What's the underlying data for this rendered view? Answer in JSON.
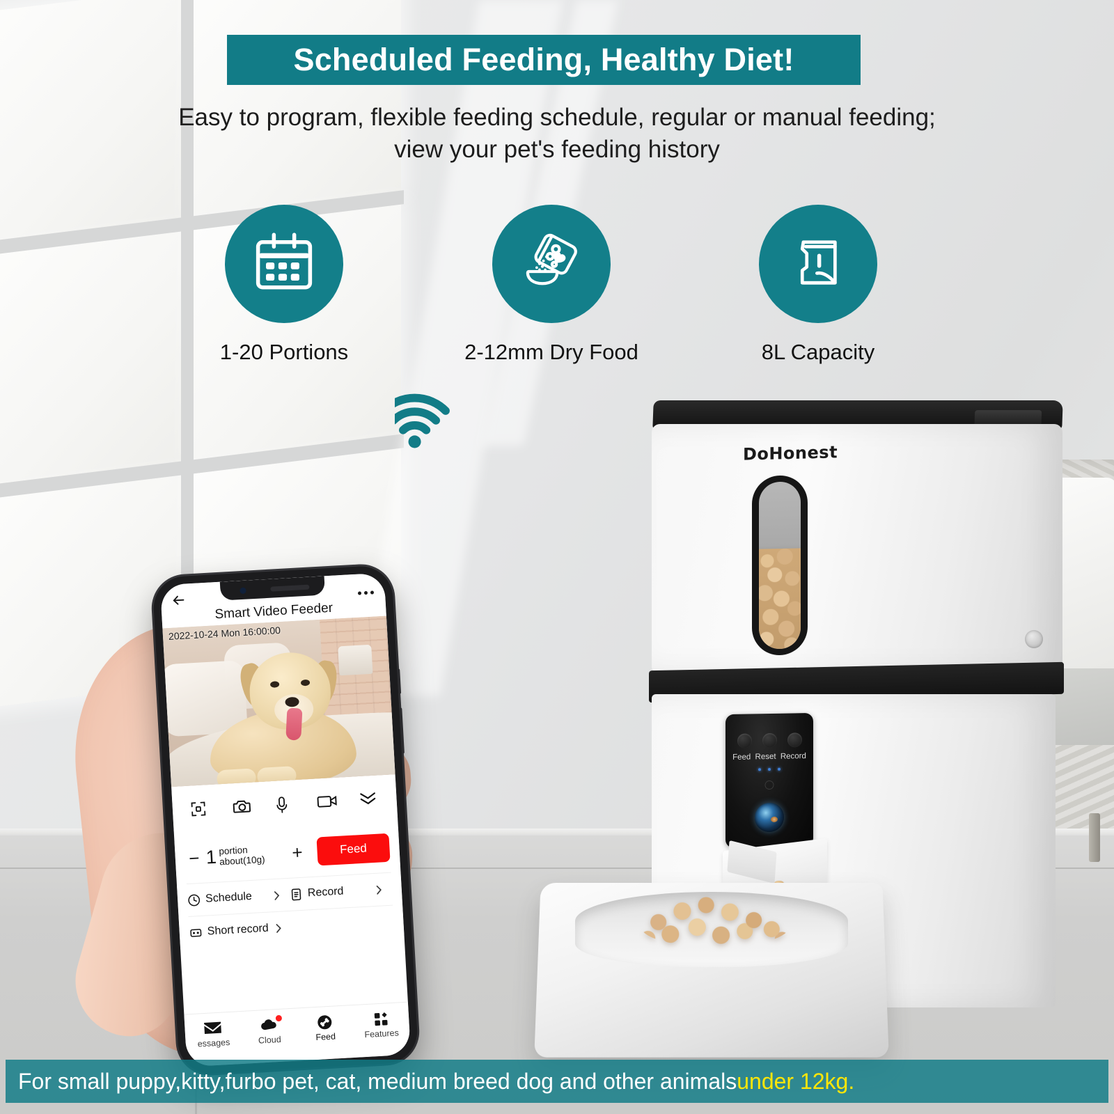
{
  "headline": "Scheduled Feeding, Healthy Diet!",
  "subheadline_line1": "Easy to program, flexible feeding schedule, regular or manual feeding;",
  "subheadline_line2": "view your pet's feeding history",
  "colors": {
    "accent_teal": "#127C87",
    "icon_bubble_teal": "#137F8A",
    "feed_button_red": "#FB0D0D",
    "highlight_yellow": "#FFE607",
    "badge_red": "#FF1F1F"
  },
  "features": [
    {
      "icon": "calendar-icon",
      "label": "1-20 Portions"
    },
    {
      "icon": "food-bag-pouring-into-bowl-icon",
      "label": "2-12mm Dry Food"
    },
    {
      "icon": "open-food-container-icon",
      "label": "8L Capacity"
    }
  ],
  "wifi": {
    "icon": "wifi-signal-icon"
  },
  "phone_app": {
    "header": {
      "back_icon": "back-arrow-icon",
      "title": "Smart Video Feeder",
      "more_icon": "more-options-icon"
    },
    "video": {
      "timestamp": "2022-10-24 Mon 16:00:00",
      "subject": "dog-live-view"
    },
    "control_icons": [
      {
        "icon": "fullscreen-icon",
        "label": "Fullscreen"
      },
      {
        "icon": "camera-icon",
        "label": "Snapshot"
      },
      {
        "icon": "microphone-icon",
        "label": "Talk"
      },
      {
        "icon": "video-camera-icon",
        "label": "Record video"
      },
      {
        "icon": "chevron-double-down-icon",
        "label": "More"
      }
    ],
    "portion": {
      "minus_label": "−",
      "count": "1",
      "unit_line1": "portion",
      "unit_line2": "about(10g)",
      "plus_label": "+",
      "feed_button_label": "Feed"
    },
    "links": [
      {
        "icon": "clock-icon",
        "label": "Schedule",
        "chevron": "chevron-right-icon"
      },
      {
        "icon": "document-icon",
        "label": "Record",
        "chevron": "chevron-right-icon"
      },
      {
        "icon": "short-record-icon",
        "label": "Short record",
        "chevron": "chevron-right-icon"
      }
    ],
    "tabs": [
      {
        "icon": "envelope-icon",
        "label": "essages",
        "active": false,
        "badge": false
      },
      {
        "icon": "cloud-icon",
        "label": "Cloud",
        "active": false,
        "badge": true
      },
      {
        "icon": "bone-icon",
        "label": "Feed",
        "active": true,
        "badge": false
      },
      {
        "icon": "grid-features-icon",
        "label": "Features",
        "active": false,
        "badge": false
      }
    ]
  },
  "feeder_device": {
    "brand": "DoHonest",
    "food_window": {
      "name": "kibble-level-window",
      "fill_percent": 60
    },
    "control_panel": {
      "buttons": [
        "Feed",
        "Reset",
        "Record"
      ],
      "led_count": 3,
      "power_icon": "power-ring-icon",
      "lens": "camera-lens"
    },
    "bowl": {
      "name": "food-bowl",
      "contains": "dry-kibble"
    }
  },
  "bottom_banner": {
    "text_white": "For small puppy,kitty,furbo pet, cat, medium breed dog and other animals ",
    "text_highlight": "under 12kg."
  }
}
